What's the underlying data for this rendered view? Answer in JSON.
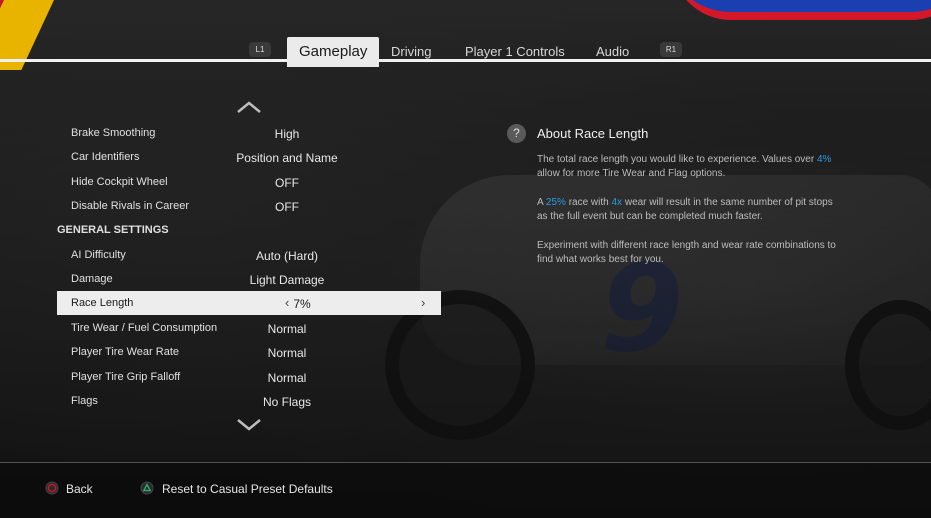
{
  "tabs": {
    "left_shoulder": "L1",
    "right_shoulder": "R1",
    "items": [
      {
        "label": "Gameplay",
        "active": true
      },
      {
        "label": "Driving",
        "active": false
      },
      {
        "label": "Player 1 Controls",
        "active": false
      },
      {
        "label": "Audio",
        "active": false
      }
    ]
  },
  "settings": {
    "rows": [
      {
        "label": "Brake Smoothing",
        "value": "High"
      },
      {
        "label": "Car Identifiers",
        "value": "Position and Name"
      },
      {
        "label": "Hide Cockpit Wheel",
        "value": "OFF"
      },
      {
        "label": "Disable Rivals in Career",
        "value": "OFF"
      },
      {
        "label": "GENERAL SETTINGS",
        "value": "",
        "section": true
      },
      {
        "label": "AI Difficulty",
        "value": "Auto (Hard)"
      },
      {
        "label": "Damage",
        "value": "Light Damage"
      },
      {
        "label": "Race Length",
        "value": "7%",
        "selected": true
      },
      {
        "label": "Tire Wear / Fuel Consumption",
        "value": "Normal"
      },
      {
        "label": "Player Tire Wear Rate",
        "value": "Normal"
      },
      {
        "label": "Player Tire Grip Falloff",
        "value": "Normal"
      },
      {
        "label": "Flags",
        "value": "No Flags"
      }
    ],
    "left_arrow": "‹",
    "right_arrow": "›"
  },
  "info": {
    "icon": "?",
    "title": "About Race Length",
    "p1_a": "The total race length you would like to experience.  Values over ",
    "p1_hl": "4%",
    "p1_b": " allow for more Tire Wear and Flag options.",
    "p2_a": "A ",
    "p2_hl1": "25%",
    "p2_b": " race with ",
    "p2_hl2": "4x",
    "p2_c": " wear will result in the same number of pit stops as the full event but can be completed much faster.",
    "p3": "Experiment with different race length and wear rate combinations to find what works best for you."
  },
  "footer": {
    "back_label": "Back",
    "reset_label": "Reset to Casual Preset Defaults",
    "circle_color": "#c0182a",
    "triangle_color": "#2fa870"
  },
  "background": {
    "car_number": "9"
  }
}
